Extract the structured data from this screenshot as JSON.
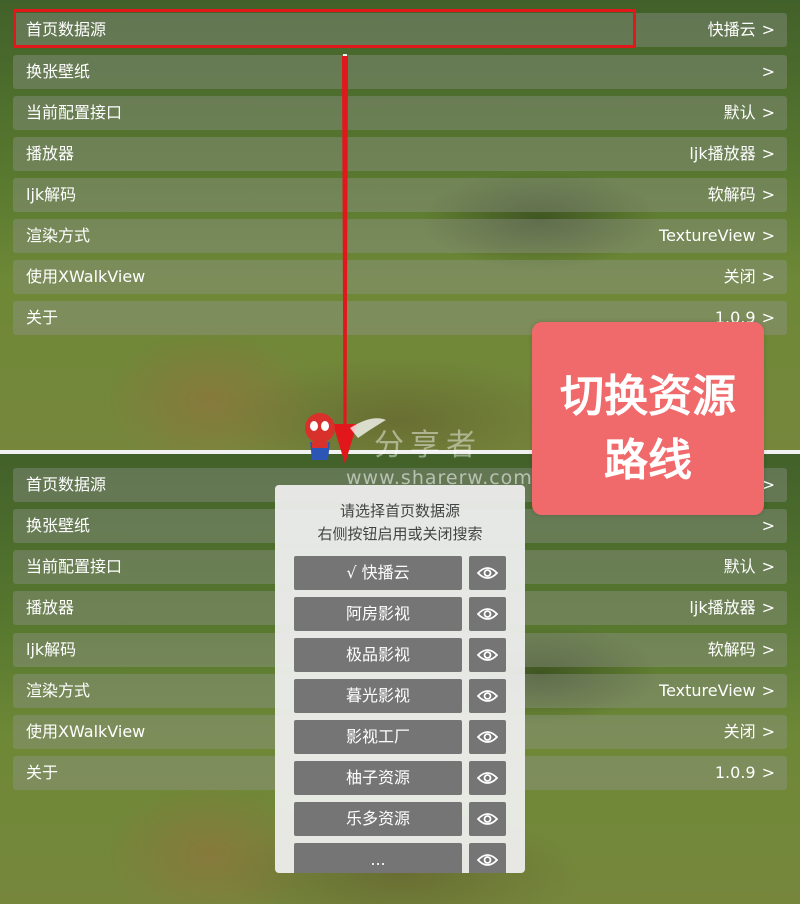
{
  "settings": {
    "rows": [
      {
        "label": "首页数据源",
        "value": "快播云"
      },
      {
        "label": "换张壁纸",
        "value": ""
      },
      {
        "label": "当前配置接口",
        "value": "默认"
      },
      {
        "label": "播放器",
        "value": "ljk播放器"
      },
      {
        "label": "ljk解码",
        "value": "软解码"
      },
      {
        "label": "渲染方式",
        "value": "TextureView"
      },
      {
        "label": "使用XWalkView",
        "value": "关闭"
      },
      {
        "label": "关于",
        "value": "1.0.9"
      }
    ],
    "chevron": ">"
  },
  "annotation": {
    "badge_line1": "切换资源",
    "badge_line2": "路线",
    "highlight_color": "#e2171b",
    "badge_color": "#f0696b"
  },
  "watermark": {
    "text_cn": "分享者",
    "url": "www.sharerw.com"
  },
  "dialog": {
    "title_line1": "请选择首页数据源",
    "title_line2": "右侧按钮启用或关闭搜索",
    "options": [
      {
        "label": "√ 快播云"
      },
      {
        "label": "阿房影视"
      },
      {
        "label": "极品影视"
      },
      {
        "label": "暮光影视"
      },
      {
        "label": "影视工厂"
      },
      {
        "label": "柚子资源"
      },
      {
        "label": "乐多资源"
      },
      {
        "label": "..."
      }
    ],
    "toggle_icon": "eye-icon"
  }
}
